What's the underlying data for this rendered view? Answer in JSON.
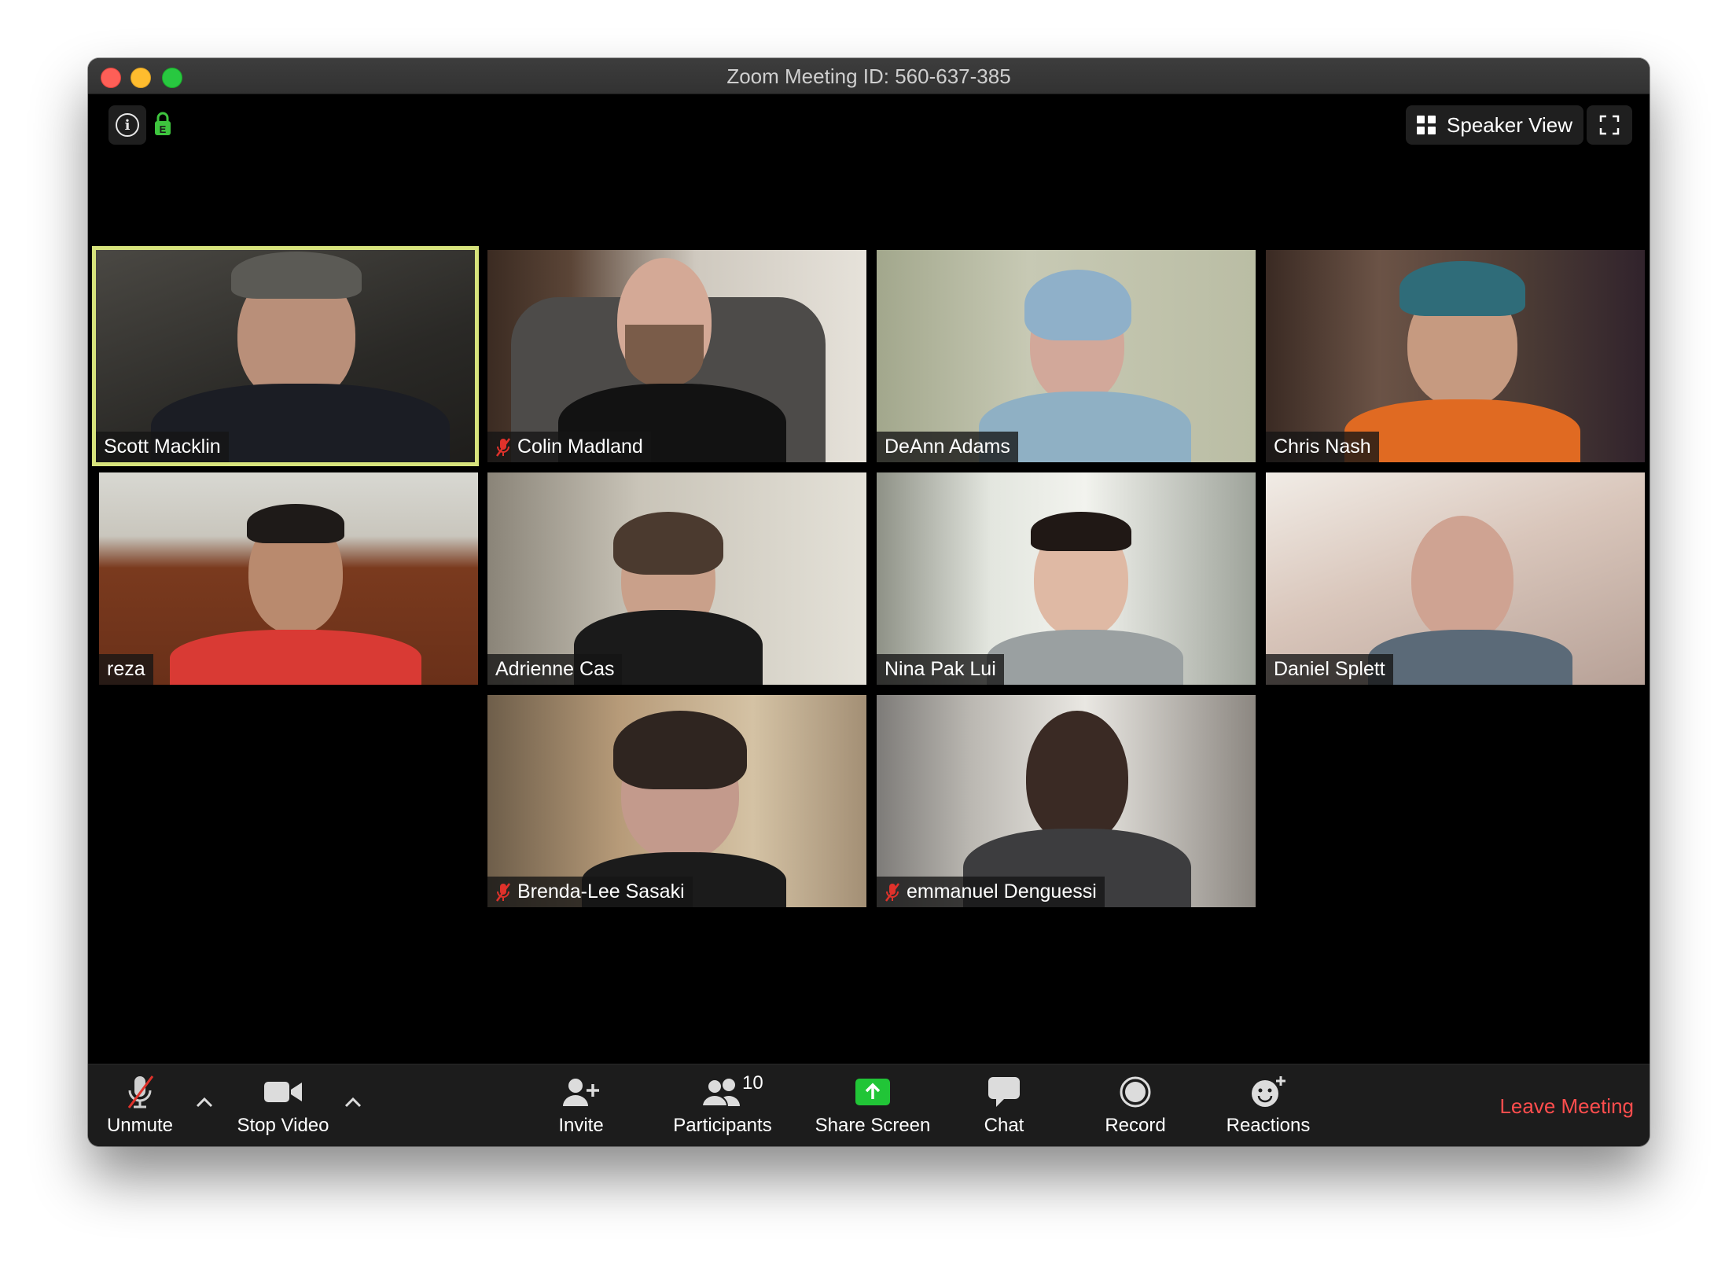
{
  "window": {
    "title": "Zoom Meeting ID: 560-637-385"
  },
  "top_controls": {
    "speaker_view_label": "Speaker View"
  },
  "participants": [
    {
      "name": "Scott Macklin",
      "muted": false,
      "active_speaker": true
    },
    {
      "name": "Colin Madland",
      "muted": true,
      "active_speaker": false
    },
    {
      "name": "DeAnn Adams",
      "muted": false,
      "active_speaker": false
    },
    {
      "name": "Chris Nash",
      "muted": false,
      "active_speaker": false
    },
    {
      "name": "reza",
      "muted": false,
      "active_speaker": false
    },
    {
      "name": "Adrienne Cas",
      "muted": false,
      "active_speaker": false
    },
    {
      "name": "Nina Pak Lui",
      "muted": false,
      "active_speaker": false
    },
    {
      "name": "Daniel Splett",
      "muted": false,
      "active_speaker": false
    },
    {
      "name": "Brenda-Lee Sasaki",
      "muted": true,
      "active_speaker": false
    },
    {
      "name": "emmanuel Denguessi",
      "muted": true,
      "active_speaker": false
    }
  ],
  "toolbar": {
    "unmute_label": "Unmute",
    "stop_video_label": "Stop Video",
    "invite_label": "Invite",
    "participants_label": "Participants",
    "participants_count": "10",
    "share_screen_label": "Share Screen",
    "chat_label": "Chat",
    "record_label": "Record",
    "reactions_label": "Reactions",
    "leave_label": "Leave Meeting"
  },
  "colors": {
    "active_speaker_border": "#d7e37c",
    "share_screen_green": "#21c537",
    "leave_red": "#ff4d4d",
    "muted_red": "#e0322b"
  }
}
